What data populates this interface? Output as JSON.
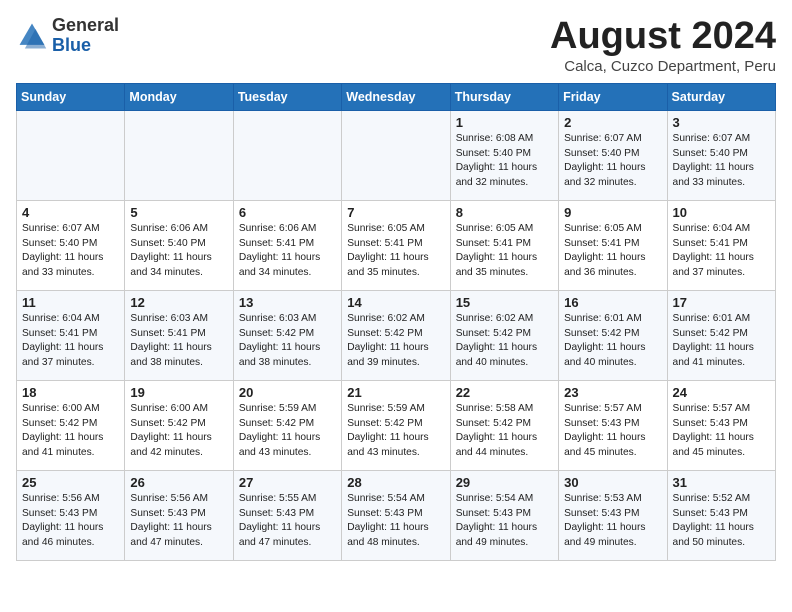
{
  "header": {
    "logo_general": "General",
    "logo_blue": "Blue",
    "month_year": "August 2024",
    "location": "Calca, Cuzco Department, Peru"
  },
  "weekdays": [
    "Sunday",
    "Monday",
    "Tuesday",
    "Wednesday",
    "Thursday",
    "Friday",
    "Saturday"
  ],
  "weeks": [
    [
      {
        "day": "",
        "sunrise": "",
        "sunset": "",
        "daylight": ""
      },
      {
        "day": "",
        "sunrise": "",
        "sunset": "",
        "daylight": ""
      },
      {
        "day": "",
        "sunrise": "",
        "sunset": "",
        "daylight": ""
      },
      {
        "day": "",
        "sunrise": "",
        "sunset": "",
        "daylight": ""
      },
      {
        "day": "1",
        "sunrise": "Sunrise: 6:08 AM",
        "sunset": "Sunset: 5:40 PM",
        "daylight": "Daylight: 11 hours and 32 minutes."
      },
      {
        "day": "2",
        "sunrise": "Sunrise: 6:07 AM",
        "sunset": "Sunset: 5:40 PM",
        "daylight": "Daylight: 11 hours and 32 minutes."
      },
      {
        "day": "3",
        "sunrise": "Sunrise: 6:07 AM",
        "sunset": "Sunset: 5:40 PM",
        "daylight": "Daylight: 11 hours and 33 minutes."
      }
    ],
    [
      {
        "day": "4",
        "sunrise": "Sunrise: 6:07 AM",
        "sunset": "Sunset: 5:40 PM",
        "daylight": "Daylight: 11 hours and 33 minutes."
      },
      {
        "day": "5",
        "sunrise": "Sunrise: 6:06 AM",
        "sunset": "Sunset: 5:40 PM",
        "daylight": "Daylight: 11 hours and 34 minutes."
      },
      {
        "day": "6",
        "sunrise": "Sunrise: 6:06 AM",
        "sunset": "Sunset: 5:41 PM",
        "daylight": "Daylight: 11 hours and 34 minutes."
      },
      {
        "day": "7",
        "sunrise": "Sunrise: 6:05 AM",
        "sunset": "Sunset: 5:41 PM",
        "daylight": "Daylight: 11 hours and 35 minutes."
      },
      {
        "day": "8",
        "sunrise": "Sunrise: 6:05 AM",
        "sunset": "Sunset: 5:41 PM",
        "daylight": "Daylight: 11 hours and 35 minutes."
      },
      {
        "day": "9",
        "sunrise": "Sunrise: 6:05 AM",
        "sunset": "Sunset: 5:41 PM",
        "daylight": "Daylight: 11 hours and 36 minutes."
      },
      {
        "day": "10",
        "sunrise": "Sunrise: 6:04 AM",
        "sunset": "Sunset: 5:41 PM",
        "daylight": "Daylight: 11 hours and 37 minutes."
      }
    ],
    [
      {
        "day": "11",
        "sunrise": "Sunrise: 6:04 AM",
        "sunset": "Sunset: 5:41 PM",
        "daylight": "Daylight: 11 hours and 37 minutes."
      },
      {
        "day": "12",
        "sunrise": "Sunrise: 6:03 AM",
        "sunset": "Sunset: 5:41 PM",
        "daylight": "Daylight: 11 hours and 38 minutes."
      },
      {
        "day": "13",
        "sunrise": "Sunrise: 6:03 AM",
        "sunset": "Sunset: 5:42 PM",
        "daylight": "Daylight: 11 hours and 38 minutes."
      },
      {
        "day": "14",
        "sunrise": "Sunrise: 6:02 AM",
        "sunset": "Sunset: 5:42 PM",
        "daylight": "Daylight: 11 hours and 39 minutes."
      },
      {
        "day": "15",
        "sunrise": "Sunrise: 6:02 AM",
        "sunset": "Sunset: 5:42 PM",
        "daylight": "Daylight: 11 hours and 40 minutes."
      },
      {
        "day": "16",
        "sunrise": "Sunrise: 6:01 AM",
        "sunset": "Sunset: 5:42 PM",
        "daylight": "Daylight: 11 hours and 40 minutes."
      },
      {
        "day": "17",
        "sunrise": "Sunrise: 6:01 AM",
        "sunset": "Sunset: 5:42 PM",
        "daylight": "Daylight: 11 hours and 41 minutes."
      }
    ],
    [
      {
        "day": "18",
        "sunrise": "Sunrise: 6:00 AM",
        "sunset": "Sunset: 5:42 PM",
        "daylight": "Daylight: 11 hours and 41 minutes."
      },
      {
        "day": "19",
        "sunrise": "Sunrise: 6:00 AM",
        "sunset": "Sunset: 5:42 PM",
        "daylight": "Daylight: 11 hours and 42 minutes."
      },
      {
        "day": "20",
        "sunrise": "Sunrise: 5:59 AM",
        "sunset": "Sunset: 5:42 PM",
        "daylight": "Daylight: 11 hours and 43 minutes."
      },
      {
        "day": "21",
        "sunrise": "Sunrise: 5:59 AM",
        "sunset": "Sunset: 5:42 PM",
        "daylight": "Daylight: 11 hours and 43 minutes."
      },
      {
        "day": "22",
        "sunrise": "Sunrise: 5:58 AM",
        "sunset": "Sunset: 5:42 PM",
        "daylight": "Daylight: 11 hours and 44 minutes."
      },
      {
        "day": "23",
        "sunrise": "Sunrise: 5:57 AM",
        "sunset": "Sunset: 5:43 PM",
        "daylight": "Daylight: 11 hours and 45 minutes."
      },
      {
        "day": "24",
        "sunrise": "Sunrise: 5:57 AM",
        "sunset": "Sunset: 5:43 PM",
        "daylight": "Daylight: 11 hours and 45 minutes."
      }
    ],
    [
      {
        "day": "25",
        "sunrise": "Sunrise: 5:56 AM",
        "sunset": "Sunset: 5:43 PM",
        "daylight": "Daylight: 11 hours and 46 minutes."
      },
      {
        "day": "26",
        "sunrise": "Sunrise: 5:56 AM",
        "sunset": "Sunset: 5:43 PM",
        "daylight": "Daylight: 11 hours and 47 minutes."
      },
      {
        "day": "27",
        "sunrise": "Sunrise: 5:55 AM",
        "sunset": "Sunset: 5:43 PM",
        "daylight": "Daylight: 11 hours and 47 minutes."
      },
      {
        "day": "28",
        "sunrise": "Sunrise: 5:54 AM",
        "sunset": "Sunset: 5:43 PM",
        "daylight": "Daylight: 11 hours and 48 minutes."
      },
      {
        "day": "29",
        "sunrise": "Sunrise: 5:54 AM",
        "sunset": "Sunset: 5:43 PM",
        "daylight": "Daylight: 11 hours and 49 minutes."
      },
      {
        "day": "30",
        "sunrise": "Sunrise: 5:53 AM",
        "sunset": "Sunset: 5:43 PM",
        "daylight": "Daylight: 11 hours and 49 minutes."
      },
      {
        "day": "31",
        "sunrise": "Sunrise: 5:52 AM",
        "sunset": "Sunset: 5:43 PM",
        "daylight": "Daylight: 11 hours and 50 minutes."
      }
    ]
  ]
}
